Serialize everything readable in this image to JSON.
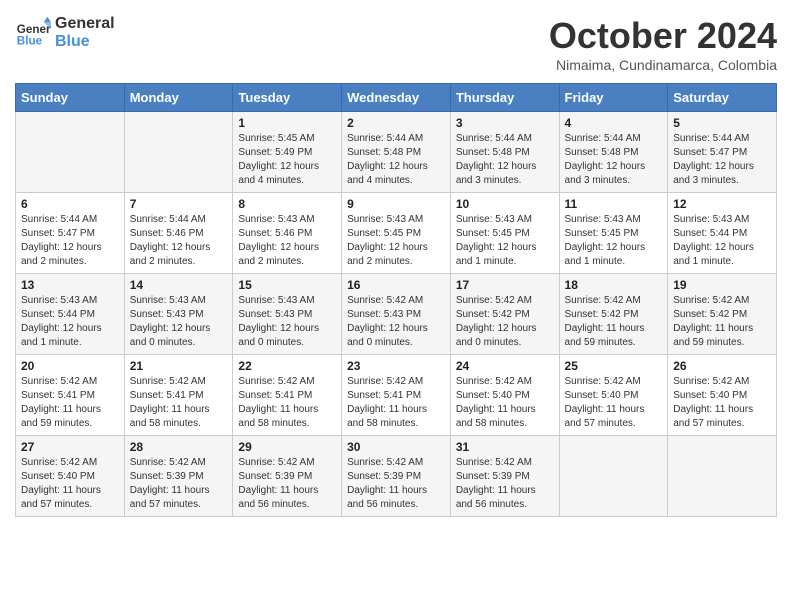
{
  "logo": {
    "line1": "General",
    "line2": "Blue"
  },
  "title": "October 2024",
  "subtitle": "Nimaima, Cundinamarca, Colombia",
  "days_of_week": [
    "Sunday",
    "Monday",
    "Tuesday",
    "Wednesday",
    "Thursday",
    "Friday",
    "Saturday"
  ],
  "weeks": [
    [
      {
        "day": "",
        "info": ""
      },
      {
        "day": "",
        "info": ""
      },
      {
        "day": "1",
        "info": "Sunrise: 5:45 AM\nSunset: 5:49 PM\nDaylight: 12 hours and 4 minutes."
      },
      {
        "day": "2",
        "info": "Sunrise: 5:44 AM\nSunset: 5:48 PM\nDaylight: 12 hours and 4 minutes."
      },
      {
        "day": "3",
        "info": "Sunrise: 5:44 AM\nSunset: 5:48 PM\nDaylight: 12 hours and 3 minutes."
      },
      {
        "day": "4",
        "info": "Sunrise: 5:44 AM\nSunset: 5:48 PM\nDaylight: 12 hours and 3 minutes."
      },
      {
        "day": "5",
        "info": "Sunrise: 5:44 AM\nSunset: 5:47 PM\nDaylight: 12 hours and 3 minutes."
      }
    ],
    [
      {
        "day": "6",
        "info": "Sunrise: 5:44 AM\nSunset: 5:47 PM\nDaylight: 12 hours and 2 minutes."
      },
      {
        "day": "7",
        "info": "Sunrise: 5:44 AM\nSunset: 5:46 PM\nDaylight: 12 hours and 2 minutes."
      },
      {
        "day": "8",
        "info": "Sunrise: 5:43 AM\nSunset: 5:46 PM\nDaylight: 12 hours and 2 minutes."
      },
      {
        "day": "9",
        "info": "Sunrise: 5:43 AM\nSunset: 5:45 PM\nDaylight: 12 hours and 2 minutes."
      },
      {
        "day": "10",
        "info": "Sunrise: 5:43 AM\nSunset: 5:45 PM\nDaylight: 12 hours and 1 minute."
      },
      {
        "day": "11",
        "info": "Sunrise: 5:43 AM\nSunset: 5:45 PM\nDaylight: 12 hours and 1 minute."
      },
      {
        "day": "12",
        "info": "Sunrise: 5:43 AM\nSunset: 5:44 PM\nDaylight: 12 hours and 1 minute."
      }
    ],
    [
      {
        "day": "13",
        "info": "Sunrise: 5:43 AM\nSunset: 5:44 PM\nDaylight: 12 hours and 1 minute."
      },
      {
        "day": "14",
        "info": "Sunrise: 5:43 AM\nSunset: 5:43 PM\nDaylight: 12 hours and 0 minutes."
      },
      {
        "day": "15",
        "info": "Sunrise: 5:43 AM\nSunset: 5:43 PM\nDaylight: 12 hours and 0 minutes."
      },
      {
        "day": "16",
        "info": "Sunrise: 5:42 AM\nSunset: 5:43 PM\nDaylight: 12 hours and 0 minutes."
      },
      {
        "day": "17",
        "info": "Sunrise: 5:42 AM\nSunset: 5:42 PM\nDaylight: 12 hours and 0 minutes."
      },
      {
        "day": "18",
        "info": "Sunrise: 5:42 AM\nSunset: 5:42 PM\nDaylight: 11 hours and 59 minutes."
      },
      {
        "day": "19",
        "info": "Sunrise: 5:42 AM\nSunset: 5:42 PM\nDaylight: 11 hours and 59 minutes."
      }
    ],
    [
      {
        "day": "20",
        "info": "Sunrise: 5:42 AM\nSunset: 5:41 PM\nDaylight: 11 hours and 59 minutes."
      },
      {
        "day": "21",
        "info": "Sunrise: 5:42 AM\nSunset: 5:41 PM\nDaylight: 11 hours and 58 minutes."
      },
      {
        "day": "22",
        "info": "Sunrise: 5:42 AM\nSunset: 5:41 PM\nDaylight: 11 hours and 58 minutes."
      },
      {
        "day": "23",
        "info": "Sunrise: 5:42 AM\nSunset: 5:41 PM\nDaylight: 11 hours and 58 minutes."
      },
      {
        "day": "24",
        "info": "Sunrise: 5:42 AM\nSunset: 5:40 PM\nDaylight: 11 hours and 58 minutes."
      },
      {
        "day": "25",
        "info": "Sunrise: 5:42 AM\nSunset: 5:40 PM\nDaylight: 11 hours and 57 minutes."
      },
      {
        "day": "26",
        "info": "Sunrise: 5:42 AM\nSunset: 5:40 PM\nDaylight: 11 hours and 57 minutes."
      }
    ],
    [
      {
        "day": "27",
        "info": "Sunrise: 5:42 AM\nSunset: 5:40 PM\nDaylight: 11 hours and 57 minutes."
      },
      {
        "day": "28",
        "info": "Sunrise: 5:42 AM\nSunset: 5:39 PM\nDaylight: 11 hours and 57 minutes."
      },
      {
        "day": "29",
        "info": "Sunrise: 5:42 AM\nSunset: 5:39 PM\nDaylight: 11 hours and 56 minutes."
      },
      {
        "day": "30",
        "info": "Sunrise: 5:42 AM\nSunset: 5:39 PM\nDaylight: 11 hours and 56 minutes."
      },
      {
        "day": "31",
        "info": "Sunrise: 5:42 AM\nSunset: 5:39 PM\nDaylight: 11 hours and 56 minutes."
      },
      {
        "day": "",
        "info": ""
      },
      {
        "day": "",
        "info": ""
      }
    ]
  ]
}
